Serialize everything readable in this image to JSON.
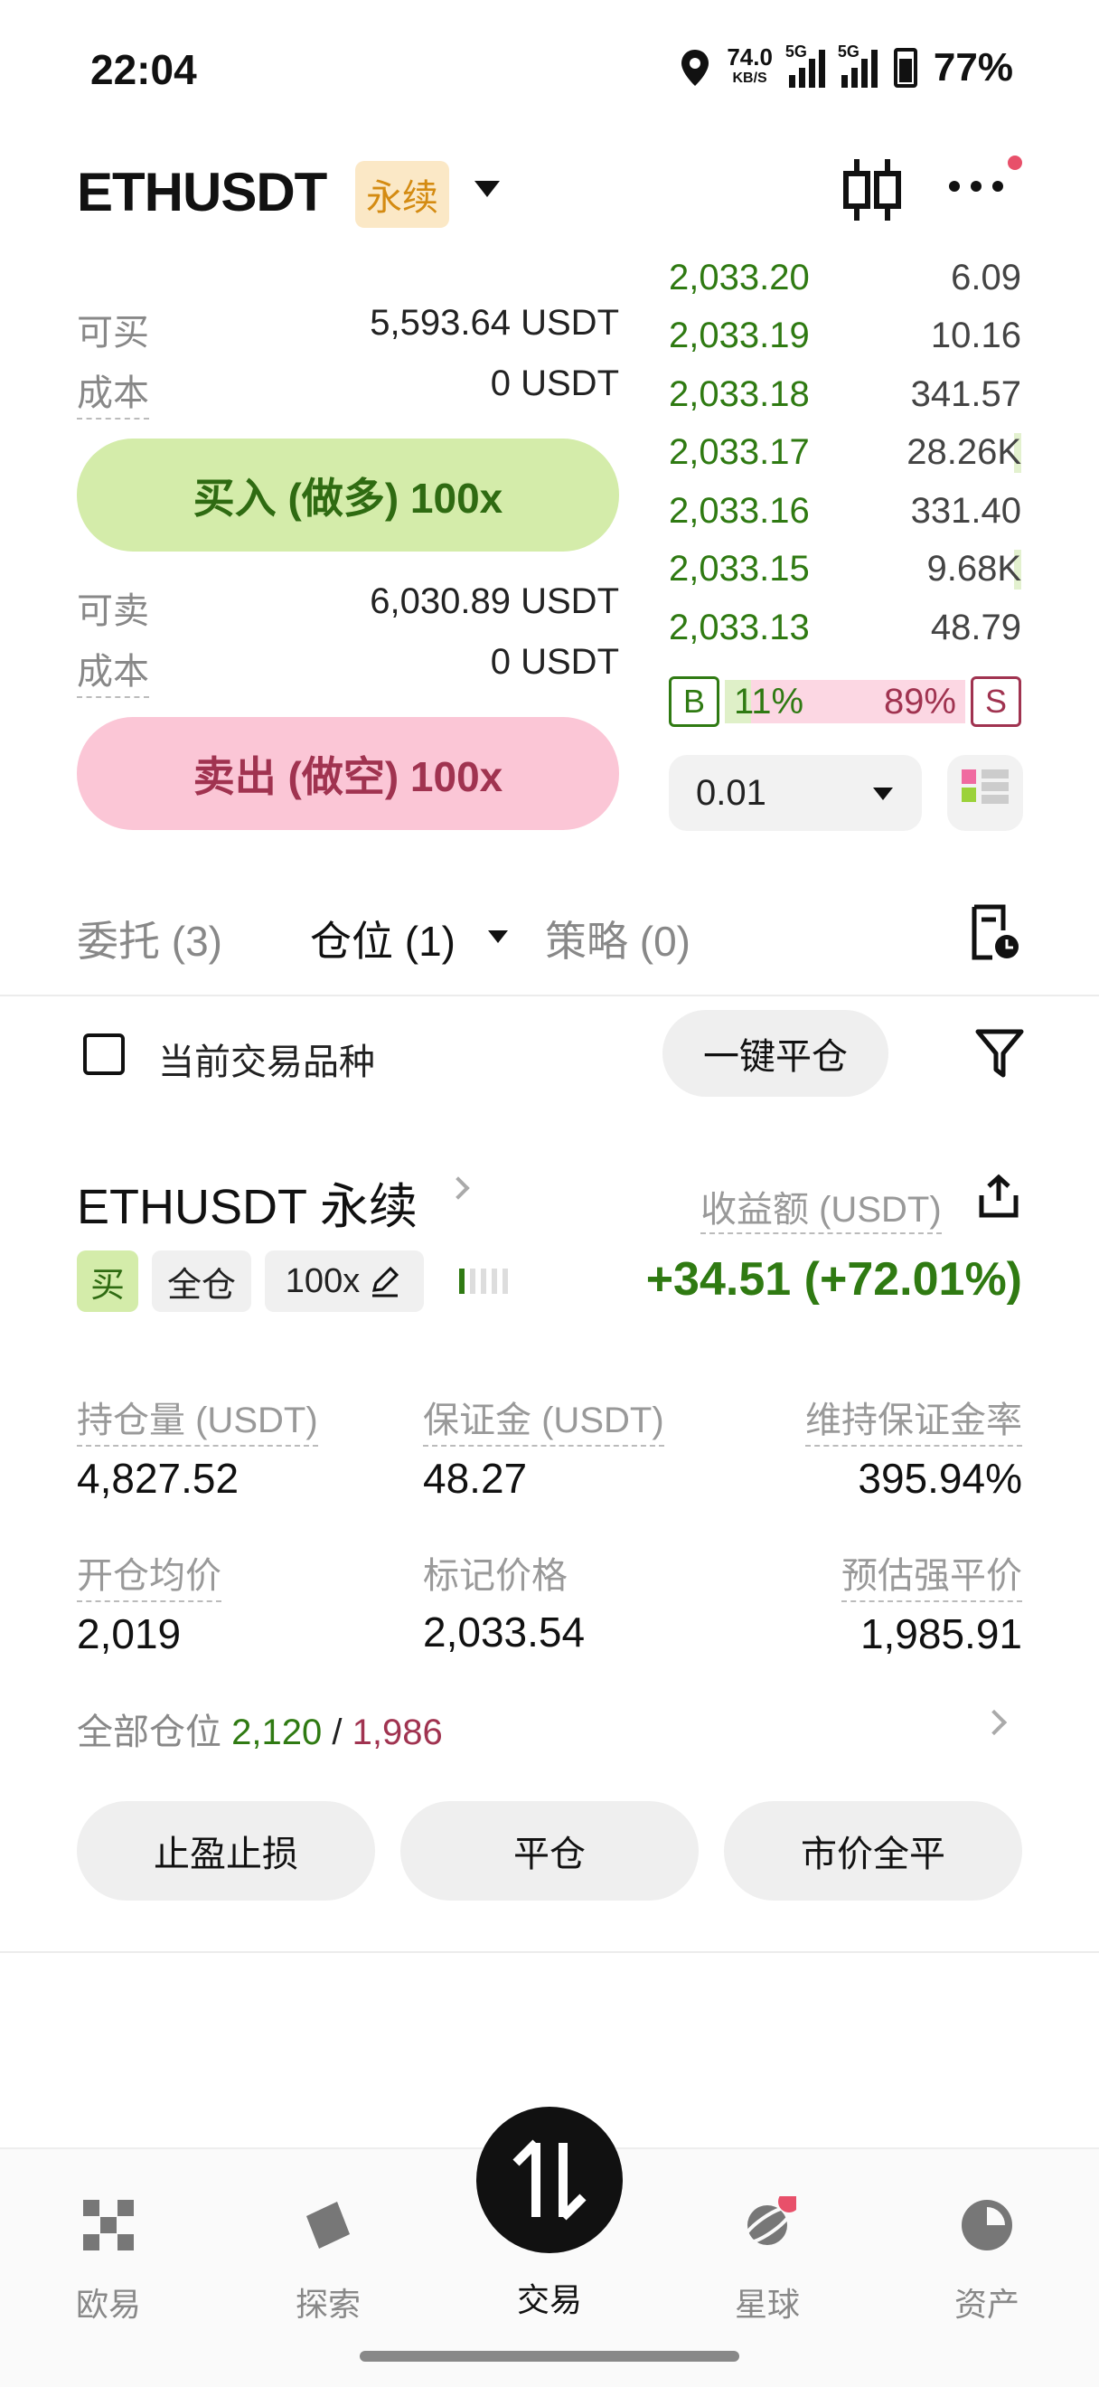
{
  "status_bar": {
    "time": "22:04",
    "net_speed": "74.0",
    "net_unit": "KB/S",
    "sim1": "5G",
    "sim2": "5G",
    "battery": "77%"
  },
  "header": {
    "symbol": "ETHUSDT",
    "badge": "永续"
  },
  "trade_panel": {
    "buy_available_label": "可买",
    "buy_available_value": "5,593.64 USDT",
    "buy_cost_label": "成本",
    "buy_cost_value": "0 USDT",
    "buy_button": "买入 (做多) 100x",
    "sell_available_label": "可卖",
    "sell_available_value": "6,030.89 USDT",
    "sell_cost_label": "成本",
    "sell_cost_value": "0 USDT",
    "sell_button": "卖出 (做空) 100x"
  },
  "order_book": {
    "rows": [
      {
        "price": "2,033.20",
        "qty": "6.09",
        "depth": 0.0
      },
      {
        "price": "2,033.19",
        "qty": "10.16",
        "depth": 0.0
      },
      {
        "price": "2,033.18",
        "qty": "341.57",
        "depth": 0.0
      },
      {
        "price": "2,033.17",
        "qty": "28.26K",
        "depth": 0.02
      },
      {
        "price": "2,033.16",
        "qty": "331.40",
        "depth": 0.0
      },
      {
        "price": "2,033.15",
        "qty": "9.68K",
        "depth": 0.01
      },
      {
        "price": "2,033.13",
        "qty": "48.79",
        "depth": 0.0
      }
    ],
    "buy_tag": "B",
    "sell_tag": "S",
    "buy_ratio": "11%",
    "sell_ratio": "89%",
    "buy_fraction": 0.11,
    "sell_fraction": 0.89,
    "quantity_step": "0.01"
  },
  "tabs": [
    {
      "label": "委托 (3)"
    },
    {
      "label": "仓位 (1)"
    },
    {
      "label": "策略 (0)"
    }
  ],
  "filter": {
    "checkbox_label": "当前交易品种",
    "close_all_button": "一键平仓"
  },
  "position": {
    "title": "ETHUSDT 永续",
    "pnl_label": "收益额 (USDT)",
    "side_tag": "买",
    "margin_mode": "全仓",
    "leverage": "100x",
    "leverage_level": 1,
    "pnl_value": "+34.51 (+72.01%)",
    "stats": [
      {
        "label": "持仓量 (USDT)",
        "value": "4,827.52"
      },
      {
        "label": "保证金 (USDT)",
        "value": "48.27"
      },
      {
        "label": "维持保证金率",
        "value": "395.94%"
      },
      {
        "label": "开仓均价",
        "value": "2,019"
      },
      {
        "label": "标记价格",
        "value": "2,033.54"
      },
      {
        "label": "预估强平价",
        "value": "1,985.91"
      }
    ],
    "all_positions_label": "全部仓位",
    "all_long": "2,120",
    "all_sep": " / ",
    "all_short": "1,986",
    "buttons": [
      "止盈止损",
      "平仓",
      "市价全平"
    ]
  },
  "bottom_nav": {
    "items": [
      "欧易",
      "探索",
      "交易",
      "星球",
      "资产"
    ]
  },
  "colors": {
    "buy_green": "#2f7a12",
    "sell_red": "#a03350",
    "buy_bg": "#d4ecaa",
    "sell_bg": "#fbc6d6",
    "badge_orange": "#d48b12"
  }
}
